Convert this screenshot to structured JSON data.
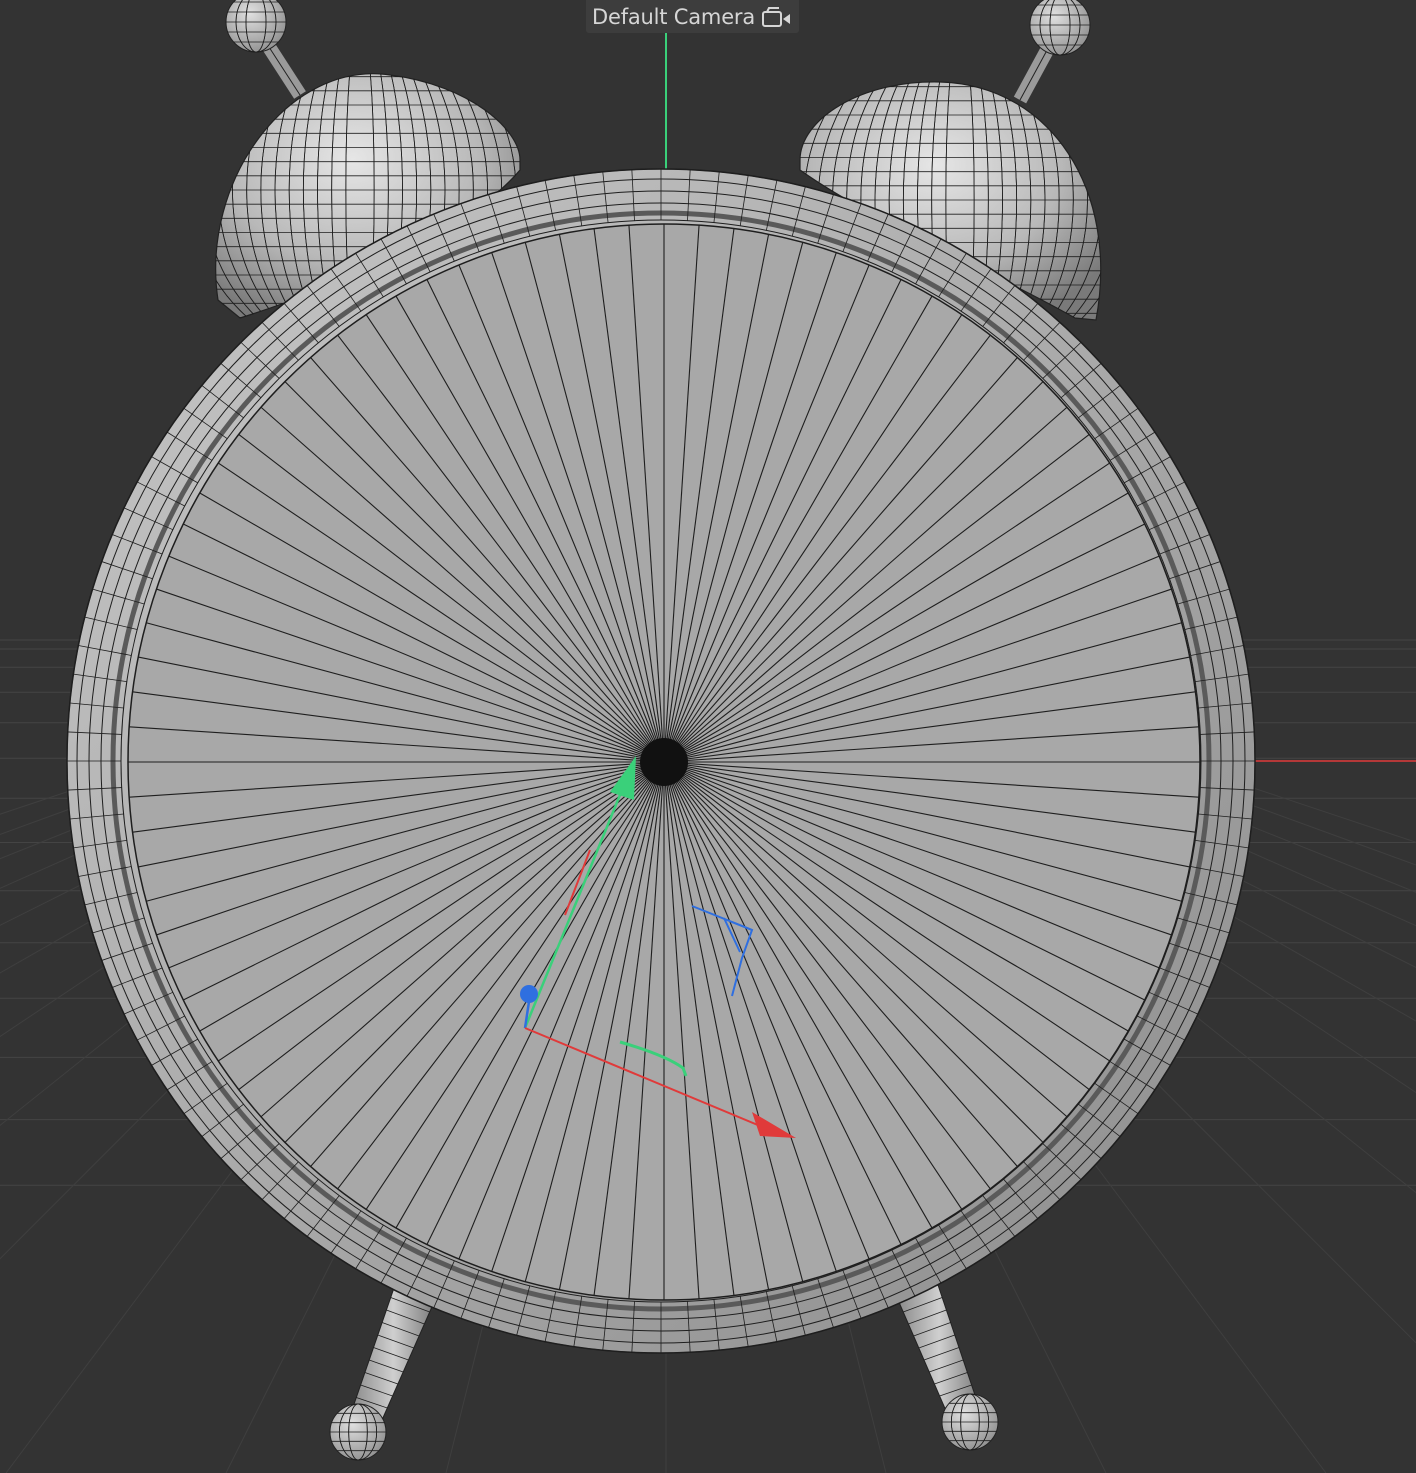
{
  "viewport": {
    "camera_label": "Default Camera",
    "camera_icon": "camera-icon",
    "background_color": "#333333",
    "grid_color": "#4a4a4a",
    "model_fill": "#a9a9a9",
    "wire_color": "#1e1e1e",
    "axis_colors": {
      "x": "#e03a3a",
      "y": "#3ad07a",
      "z": "#2f6fe0"
    }
  }
}
